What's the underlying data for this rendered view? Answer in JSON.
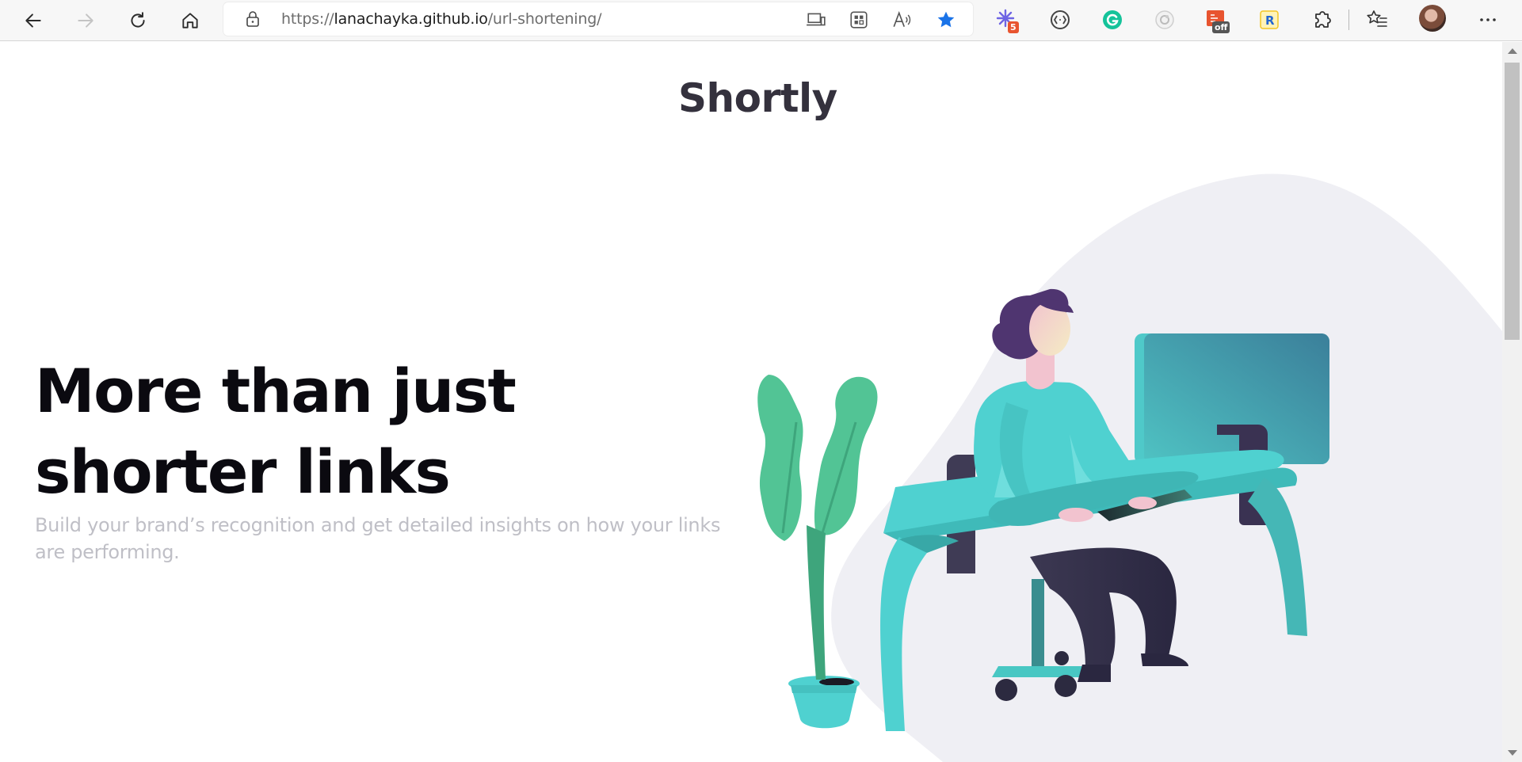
{
  "browser": {
    "url_prefix": "https://",
    "url_host": "lanachayka.github.io",
    "url_path": "/url-shortening/",
    "extensions": [
      {
        "name": "tracker-extension-icon",
        "badge": "5"
      },
      {
        "name": "code-extension-icon",
        "badge": ""
      },
      {
        "name": "grammarly-icon",
        "badge": ""
      },
      {
        "name": "record-extension-icon",
        "badge": ""
      },
      {
        "name": "off-extension-icon",
        "badge": "off"
      },
      {
        "name": "r-extension-icon",
        "badge": ""
      }
    ],
    "accent_color": "#1a73e8"
  },
  "page": {
    "logo": "Shortly",
    "headline": "More than just shorter links",
    "subtext": "Build your brand’s recognition and get detailed insights on how your links are performing.",
    "colors": {
      "logo": "#34313d",
      "headline": "#0b0a10",
      "subtext": "#bfbfc6",
      "illustration_bg": "#efeff4",
      "teal": "#4fd1d0",
      "plant": "#52c495",
      "hair": "#4f3570"
    }
  }
}
